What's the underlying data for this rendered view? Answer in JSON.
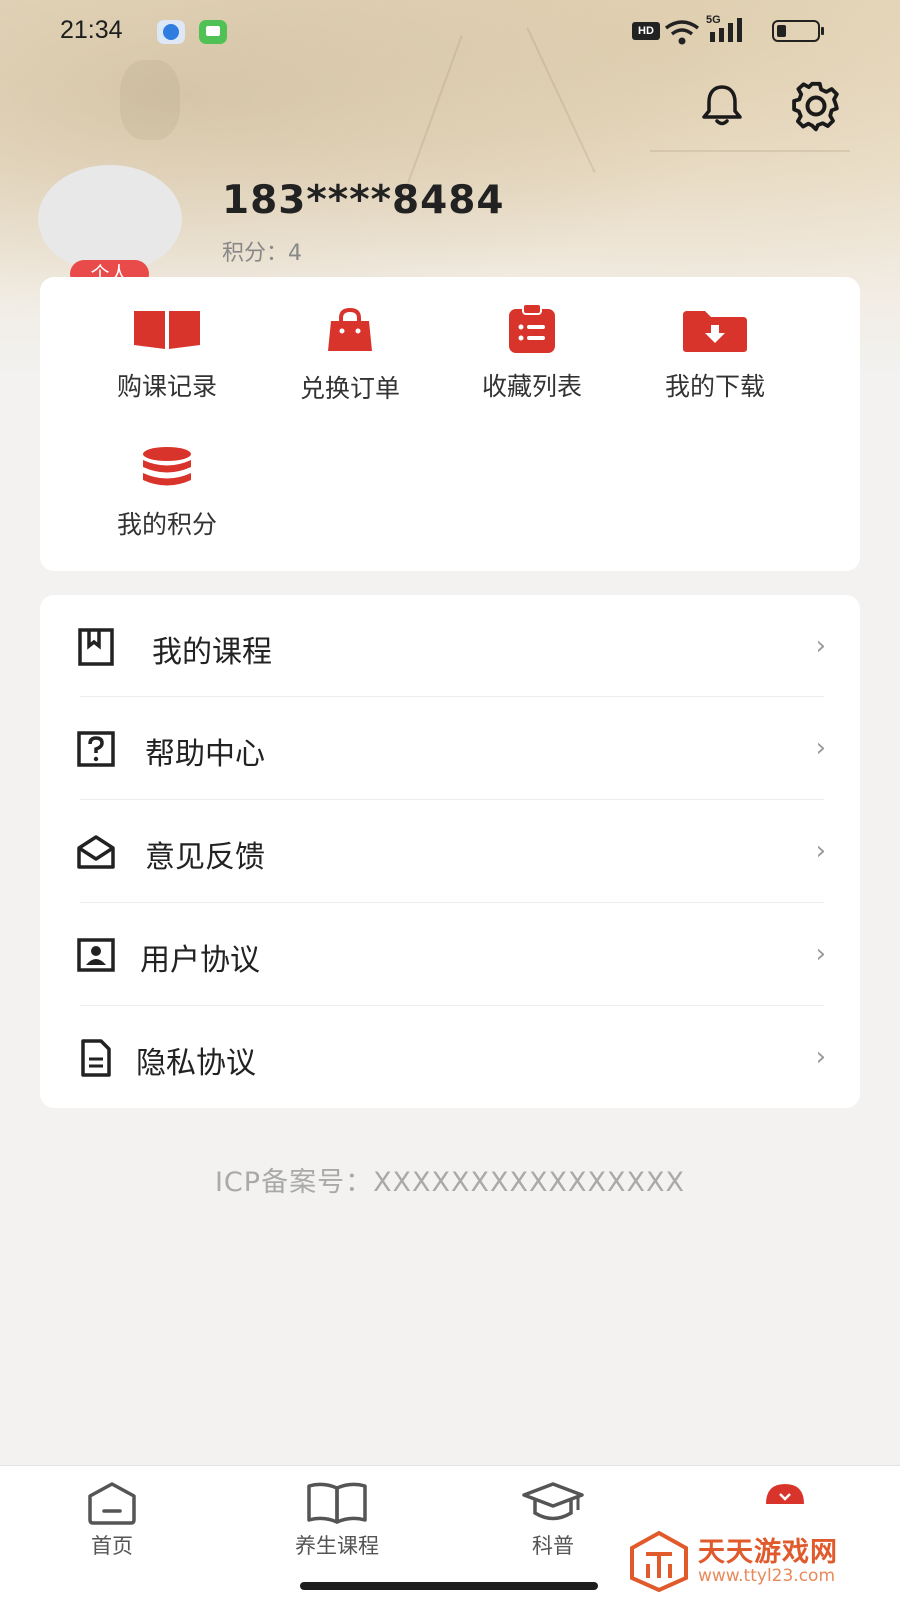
{
  "status_bar": {
    "time": "21:34",
    "hd": "HD",
    "net": "5G"
  },
  "header": {
    "bell_icon": "bell-icon",
    "settings_icon": "gear-icon"
  },
  "profile": {
    "phone": "183****8484",
    "points_label": "积分：",
    "points_value": "4",
    "badge": "个人"
  },
  "quick_actions": [
    {
      "label": "购课记录",
      "icon": "book-open-icon"
    },
    {
      "label": "兑换订单",
      "icon": "shopping-bag-icon"
    },
    {
      "label": "收藏列表",
      "icon": "clipboard-list-icon"
    },
    {
      "label": "我的下载",
      "icon": "folder-download-icon"
    },
    {
      "label": "我的积分",
      "icon": "coins-stack-icon"
    }
  ],
  "menu": [
    {
      "label": "我的课程",
      "icon": "bookmark-book-icon"
    },
    {
      "label": "帮助中心",
      "icon": "question-box-icon"
    },
    {
      "label": "意见反馈",
      "icon": "envelope-open-icon"
    },
    {
      "label": "用户协议",
      "icon": "id-card-icon"
    },
    {
      "label": "隐私协议",
      "icon": "document-icon"
    }
  ],
  "chevron": "›",
  "footer": {
    "icp": "ICP备案号：XXXXXXXXXXXXXXXX"
  },
  "tabbar": [
    {
      "label": "首页",
      "icon": "home-icon"
    },
    {
      "label": "养生课程",
      "icon": "open-book-icon"
    },
    {
      "label": "科普",
      "icon": "graduation-cap-icon"
    },
    {
      "label": "",
      "icon": "profile-active-icon"
    }
  ],
  "watermark": {
    "title": "天天游戏网",
    "url": "www.ttyl23.com"
  },
  "colors": {
    "accent": "#d9342b",
    "badge": "#e94b4b",
    "text": "#222222",
    "muted": "#a9a9a9"
  }
}
